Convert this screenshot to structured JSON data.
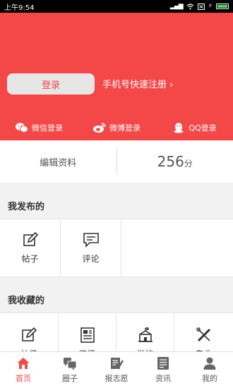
{
  "status_bar": {
    "time": "上午9:54"
  },
  "hero": {
    "login_label": "登录",
    "register_label": "手机号快速注册",
    "register_chevron": "›",
    "third_party": [
      {
        "label": "微信登录",
        "icon": "wechat-icon"
      },
      {
        "label": "微博登录",
        "icon": "weibo-icon"
      },
      {
        "label": "QQ登录",
        "icon": "qq-icon"
      }
    ]
  },
  "profile": {
    "edit_label": "编辑资料",
    "score_value": "256",
    "score_unit": "分"
  },
  "published": {
    "title": "我发布的",
    "items": [
      {
        "label": "帖子",
        "icon": "edit-icon"
      },
      {
        "label": "评论",
        "icon": "comment-icon"
      }
    ]
  },
  "favorites": {
    "title": "我收藏的",
    "items": [
      {
        "label": "帖子",
        "icon": "edit-icon"
      },
      {
        "label": "资讯",
        "icon": "news-icon"
      },
      {
        "label": "学校",
        "icon": "school-icon"
      },
      {
        "label": "专业",
        "icon": "major-icon"
      }
    ]
  },
  "tabs": [
    {
      "label": "首页",
      "icon": "home-icon",
      "active": true
    },
    {
      "label": "圈子",
      "icon": "circle-icon"
    },
    {
      "label": "报志愿",
      "icon": "apply-icon"
    },
    {
      "label": "资讯",
      "icon": "news-icon"
    },
    {
      "label": "我的",
      "icon": "user-icon"
    }
  ],
  "colors": {
    "accent": "#f44848"
  }
}
